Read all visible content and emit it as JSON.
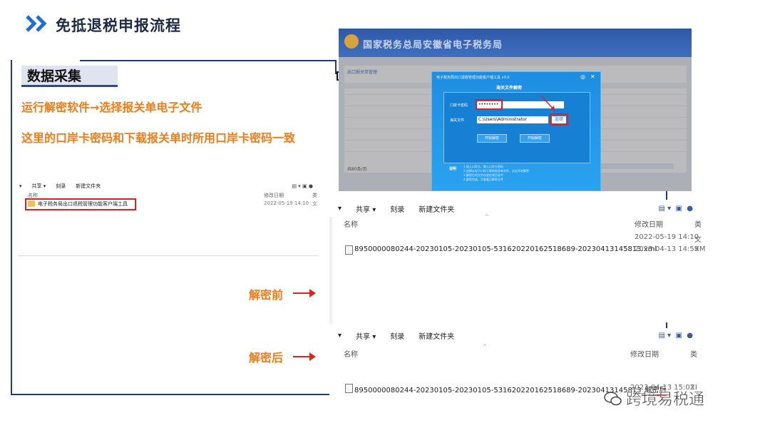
{
  "slide": {
    "title": "免抵退税申报流程",
    "section_heading": "数据采集",
    "note1": "运行解密软件→选择报关单电子文件",
    "note2": "这里的口岸卡密码和下载报关单时所用口岸卡密码一致",
    "label_before": "解密前",
    "label_after": "解密后",
    "watermark": "跨境易税通",
    "colors": {
      "accent_orange": "#f07c18",
      "frame_blue": "#1f3b78",
      "arrow_red": "#e0241b"
    }
  },
  "small_explorer": {
    "toolbar": [
      "共享 ▾",
      "刻录",
      "新建文件夹"
    ],
    "col_name": "名称",
    "col_date": "修改日期",
    "col_type": "类",
    "row": {
      "name": "电子税务局出口退税管理功能客户端工具",
      "date": "2022-05-19 14:10",
      "type": "文"
    }
  },
  "browser": {
    "header": "国家税务总局安徽省电子税务局",
    "dialog_title": "电子税务局出口退税管理功能客户端工具 v3.0",
    "dialog_sub": "海关文件解密",
    "label_card": "口岸卡密码",
    "password": "••••••••",
    "label_file": "海关文件",
    "path": "C:\\Users\\Administrator",
    "choose_btn": "选择",
    "btn_left": "开始解密",
    "btn_right": "开始解密",
    "hint_title": "说明",
    "hint_lines": [
      "1.插入口岸卡，输入口岸卡密码",
      "2.选择从电子口岸下载的报关单文件，点击开始解密",
      "3.解密后的文件存放在原目录中",
      "4.解密完成，可查看已解密文件"
    ],
    "tab": "出口报关单管理",
    "pager": "共80条/页"
  },
  "explorer_before": {
    "toolbar": [
      "共享 ▾",
      "刻录",
      "新建文件夹"
    ],
    "col_name": "名称",
    "col_date": "修改日期",
    "col_type": "类",
    "row1_date": "2022-05-19 14:10",
    "row1_type": "文",
    "row2_name": "8950000080244-20230105-20230105-531620220162518689-20230413145813.xml",
    "row2_date": "2023-04-13 14:59",
    "row2_type": "XM"
  },
  "explorer_after": {
    "toolbar": [
      "共享 ▾",
      "刻录",
      "新建文件夹"
    ],
    "col_name": "名称",
    "col_date": "修改日期",
    "col_type": "类",
    "row_name_prefix": "8950000080244-20230105-20230105-531620220162518689-20230413145813",
    "row_name_suffix": "_解密后",
    "row_date": "2023-04-13 15:02",
    "row_type": "XI"
  }
}
